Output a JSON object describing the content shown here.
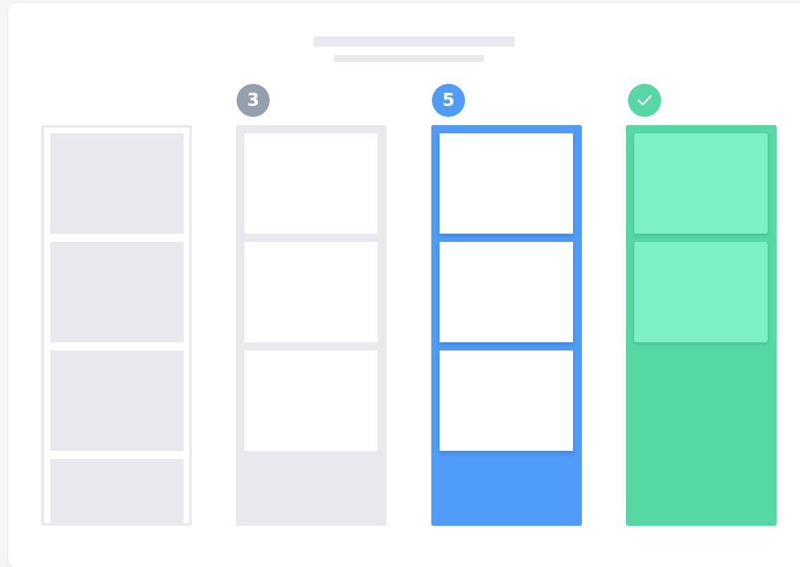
{
  "board": {
    "columns": [
      {
        "id": "col-1",
        "style": "outline",
        "badge": null,
        "visible_cards": 4
      },
      {
        "id": "col-2",
        "style": "grey",
        "badge": {
          "type": "count",
          "value": "3",
          "color": "#969fad"
        },
        "visible_cards": 3
      },
      {
        "id": "col-3",
        "style": "blue",
        "badge": {
          "type": "count",
          "value": "5",
          "color": "#4f9cf9"
        },
        "visible_cards": 3
      },
      {
        "id": "col-4",
        "style": "green",
        "badge": {
          "type": "icon",
          "icon": "check-icon",
          "color": "#56d8a5"
        },
        "visible_cards": 2
      }
    ]
  },
  "colors": {
    "placeholder": "#e8e9ed",
    "blue": "#4f9cf9",
    "green": "#56d8a5",
    "green_card": "#7cf2c4",
    "grey_badge": "#969fad"
  }
}
